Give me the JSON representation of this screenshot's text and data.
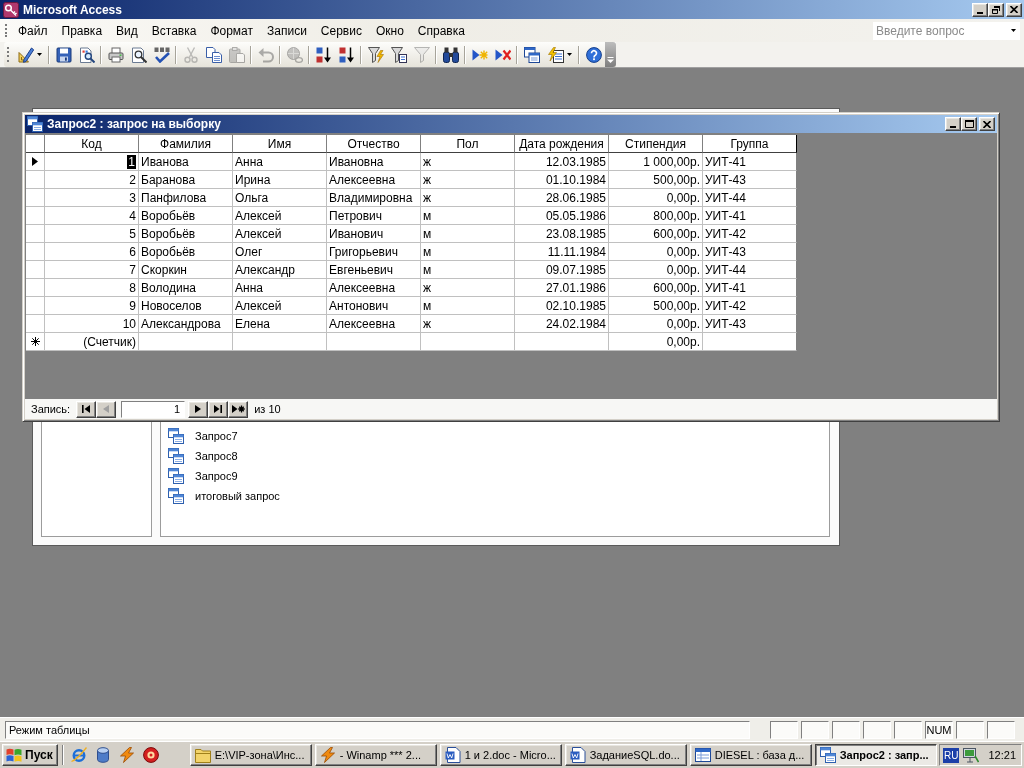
{
  "app_window": {
    "title": "Microsoft Access",
    "maximized": true
  },
  "menu_bar": {
    "items": [
      {
        "label": "Файл"
      },
      {
        "label": "Правка"
      },
      {
        "label": "Вид"
      },
      {
        "label": "Вставка"
      },
      {
        "label": "Формат"
      },
      {
        "label": "Записи"
      },
      {
        "label": "Сервис"
      },
      {
        "label": "Окно"
      },
      {
        "label": "Справка"
      }
    ],
    "question_box": {
      "placeholder": "Введите вопрос"
    }
  },
  "toolbar": {
    "groups": [
      {
        "buttons": [
          {
            "kind": "view",
            "dropdown": true,
            "disabled": false
          }
        ]
      },
      {
        "buttons": [
          {
            "kind": "save",
            "dropdown": false,
            "disabled": false
          },
          {
            "kind": "file_search",
            "dropdown": false,
            "disabled": false
          }
        ]
      },
      {
        "buttons": [
          {
            "kind": "print",
            "dropdown": false,
            "disabled": false
          },
          {
            "kind": "preview",
            "dropdown": false,
            "disabled": false
          },
          {
            "kind": "spelling",
            "dropdown": false,
            "disabled": false
          }
        ]
      },
      {
        "buttons": [
          {
            "kind": "cut",
            "dropdown": false,
            "disabled": true
          },
          {
            "kind": "copy",
            "dropdown": false,
            "disabled": false
          },
          {
            "kind": "paste",
            "dropdown": false,
            "disabled": true
          }
        ]
      },
      {
        "buttons": [
          {
            "kind": "undo",
            "dropdown": false,
            "disabled": true
          }
        ]
      },
      {
        "buttons": [
          {
            "kind": "hyperlink",
            "dropdown": false,
            "disabled": true
          }
        ]
      },
      {
        "buttons": [
          {
            "kind": "sort_ascending",
            "dropdown": false,
            "disabled": false
          },
          {
            "kind": "sort_descending",
            "dropdown": false,
            "disabled": false
          }
        ]
      },
      {
        "buttons": [
          {
            "kind": "filter_by_selection",
            "dropdown": false,
            "disabled": false
          },
          {
            "kind": "filter_by_form",
            "dropdown": false,
            "disabled": false
          },
          {
            "kind": "apply_filter",
            "dropdown": false,
            "disabled": true
          }
        ]
      },
      {
        "buttons": [
          {
            "kind": "find",
            "dropdown": false,
            "disabled": false
          }
        ]
      },
      {
        "buttons": [
          {
            "kind": "new_record",
            "dropdown": false,
            "disabled": false
          },
          {
            "kind": "delete_record",
            "dropdown": false,
            "disabled": false
          }
        ]
      },
      {
        "buttons": [
          {
            "kind": "database_window",
            "dropdown": false,
            "disabled": false
          },
          {
            "kind": "new_object",
            "dropdown": true,
            "disabled": false
          }
        ]
      },
      {
        "buttons": [
          {
            "kind": "help",
            "dropdown": false,
            "disabled": false
          }
        ]
      }
    ]
  },
  "database_window": {
    "objects": [
      {
        "label": "Запрос7"
      },
      {
        "label": "Запрос8"
      },
      {
        "label": "Запрос9"
      },
      {
        "label": "итоговый запрос"
      }
    ]
  },
  "query_window": {
    "title": "Запрос2 : запрос на выборку",
    "maximized": false,
    "datasheet": {
      "columns": [
        {
          "label": "Код",
          "kind": "number",
          "new_row_value": "(Счетчик)"
        },
        {
          "label": "Фамилия",
          "kind": "text"
        },
        {
          "label": "Имя",
          "kind": "text"
        },
        {
          "label": "Отчество",
          "kind": "text"
        },
        {
          "label": "Пол",
          "kind": "text"
        },
        {
          "label": "Дата рождения",
          "kind": "date"
        },
        {
          "label": "Стипендия",
          "kind": "currency",
          "new_row_value": "0,00р."
        },
        {
          "label": "Группа",
          "kind": "text"
        }
      ],
      "rows": [
        {
          "current": true,
          "cells": [
            "1",
            "Иванова",
            "Анна",
            "Ивановна",
            "ж",
            "12.03.1985",
            "1 000,00р.",
            "УИТ-41"
          ]
        },
        {
          "current": false,
          "cells": [
            "2",
            "Баранова",
            "Ирина",
            "Алексеевна",
            "ж",
            "01.10.1984",
            "500,00р.",
            "УИТ-43"
          ]
        },
        {
          "current": false,
          "cells": [
            "3",
            "Панфилова",
            "Ольга",
            "Владимировна",
            "ж",
            "28.06.1985",
            "0,00р.",
            "УИТ-44"
          ]
        },
        {
          "current": false,
          "cells": [
            "4",
            "Воробьёв",
            "Алексей",
            "Петрович",
            "м",
            "05.05.1986",
            "800,00р.",
            "УИТ-41"
          ]
        },
        {
          "current": false,
          "cells": [
            "5",
            "Воробьёв",
            "Алексей",
            "Иванович",
            "м",
            "23.08.1985",
            "600,00р.",
            "УИТ-42"
          ]
        },
        {
          "current": false,
          "cells": [
            "6",
            "Воробьёв",
            "Олег",
            "Григорьевич",
            "м",
            "11.11.1984",
            "0,00р.",
            "УИТ-43"
          ]
        },
        {
          "current": false,
          "cells": [
            "7",
            "Скоркин",
            "Александр",
            "Евгеньевич",
            "м",
            "09.07.1985",
            "0,00р.",
            "УИТ-44"
          ]
        },
        {
          "current": false,
          "cells": [
            "8",
            "Володина",
            "Анна",
            "Алексеевна",
            "ж",
            "27.01.1986",
            "600,00р.",
            "УИТ-41"
          ]
        },
        {
          "current": false,
          "cells": [
            "9",
            "Новоселов",
            "Алексей",
            "Антонович",
            "м",
            "02.10.1985",
            "500,00р.",
            "УИТ-42"
          ]
        },
        {
          "current": false,
          "cells": [
            "10",
            "Александрова",
            "Елена",
            "Алексеевна",
            "ж",
            "24.02.1984",
            "0,00р.",
            "УИТ-43"
          ]
        }
      ]
    },
    "navigation": {
      "label": "Запись:",
      "back_buttons": [
        {
          "kind": "first",
          "disabled": false
        },
        {
          "kind": "previous",
          "disabled": true
        }
      ],
      "record_field": "1",
      "forward_buttons": [
        {
          "kind": "next",
          "disabled": false
        },
        {
          "kind": "last",
          "disabled": false
        },
        {
          "kind": "new",
          "disabled": false
        }
      ],
      "total": "из 10"
    }
  },
  "status_bar": {
    "mode": "Режим таблицы",
    "indicators": [
      {
        "label": "NUM"
      }
    ]
  },
  "taskbar": {
    "start_button": {
      "label": "Пуск"
    },
    "quick_launch": [
      {
        "kind": "browser"
      },
      {
        "kind": "app"
      },
      {
        "kind": "player"
      },
      {
        "kind": "media"
      }
    ],
    "tasks": [
      {
        "kind": "folder",
        "label": "E:\\VIP-зона\\Инс...",
        "selected": false
      },
      {
        "kind": "player",
        "label": "- Winamp *** 2...",
        "selected": false
      },
      {
        "kind": "document",
        "label": "1 и 2.doc - Micro...",
        "selected": false
      },
      {
        "kind": "document",
        "label": "ЗаданиеSQL.do...",
        "selected": false
      },
      {
        "kind": "database",
        "label": "DIESEL : база д...",
        "selected": false
      },
      {
        "kind": "query",
        "label": "Запрос2 : запр...",
        "selected": true
      }
    ],
    "tray": {
      "language": "RU",
      "clock": "12:21"
    }
  }
}
